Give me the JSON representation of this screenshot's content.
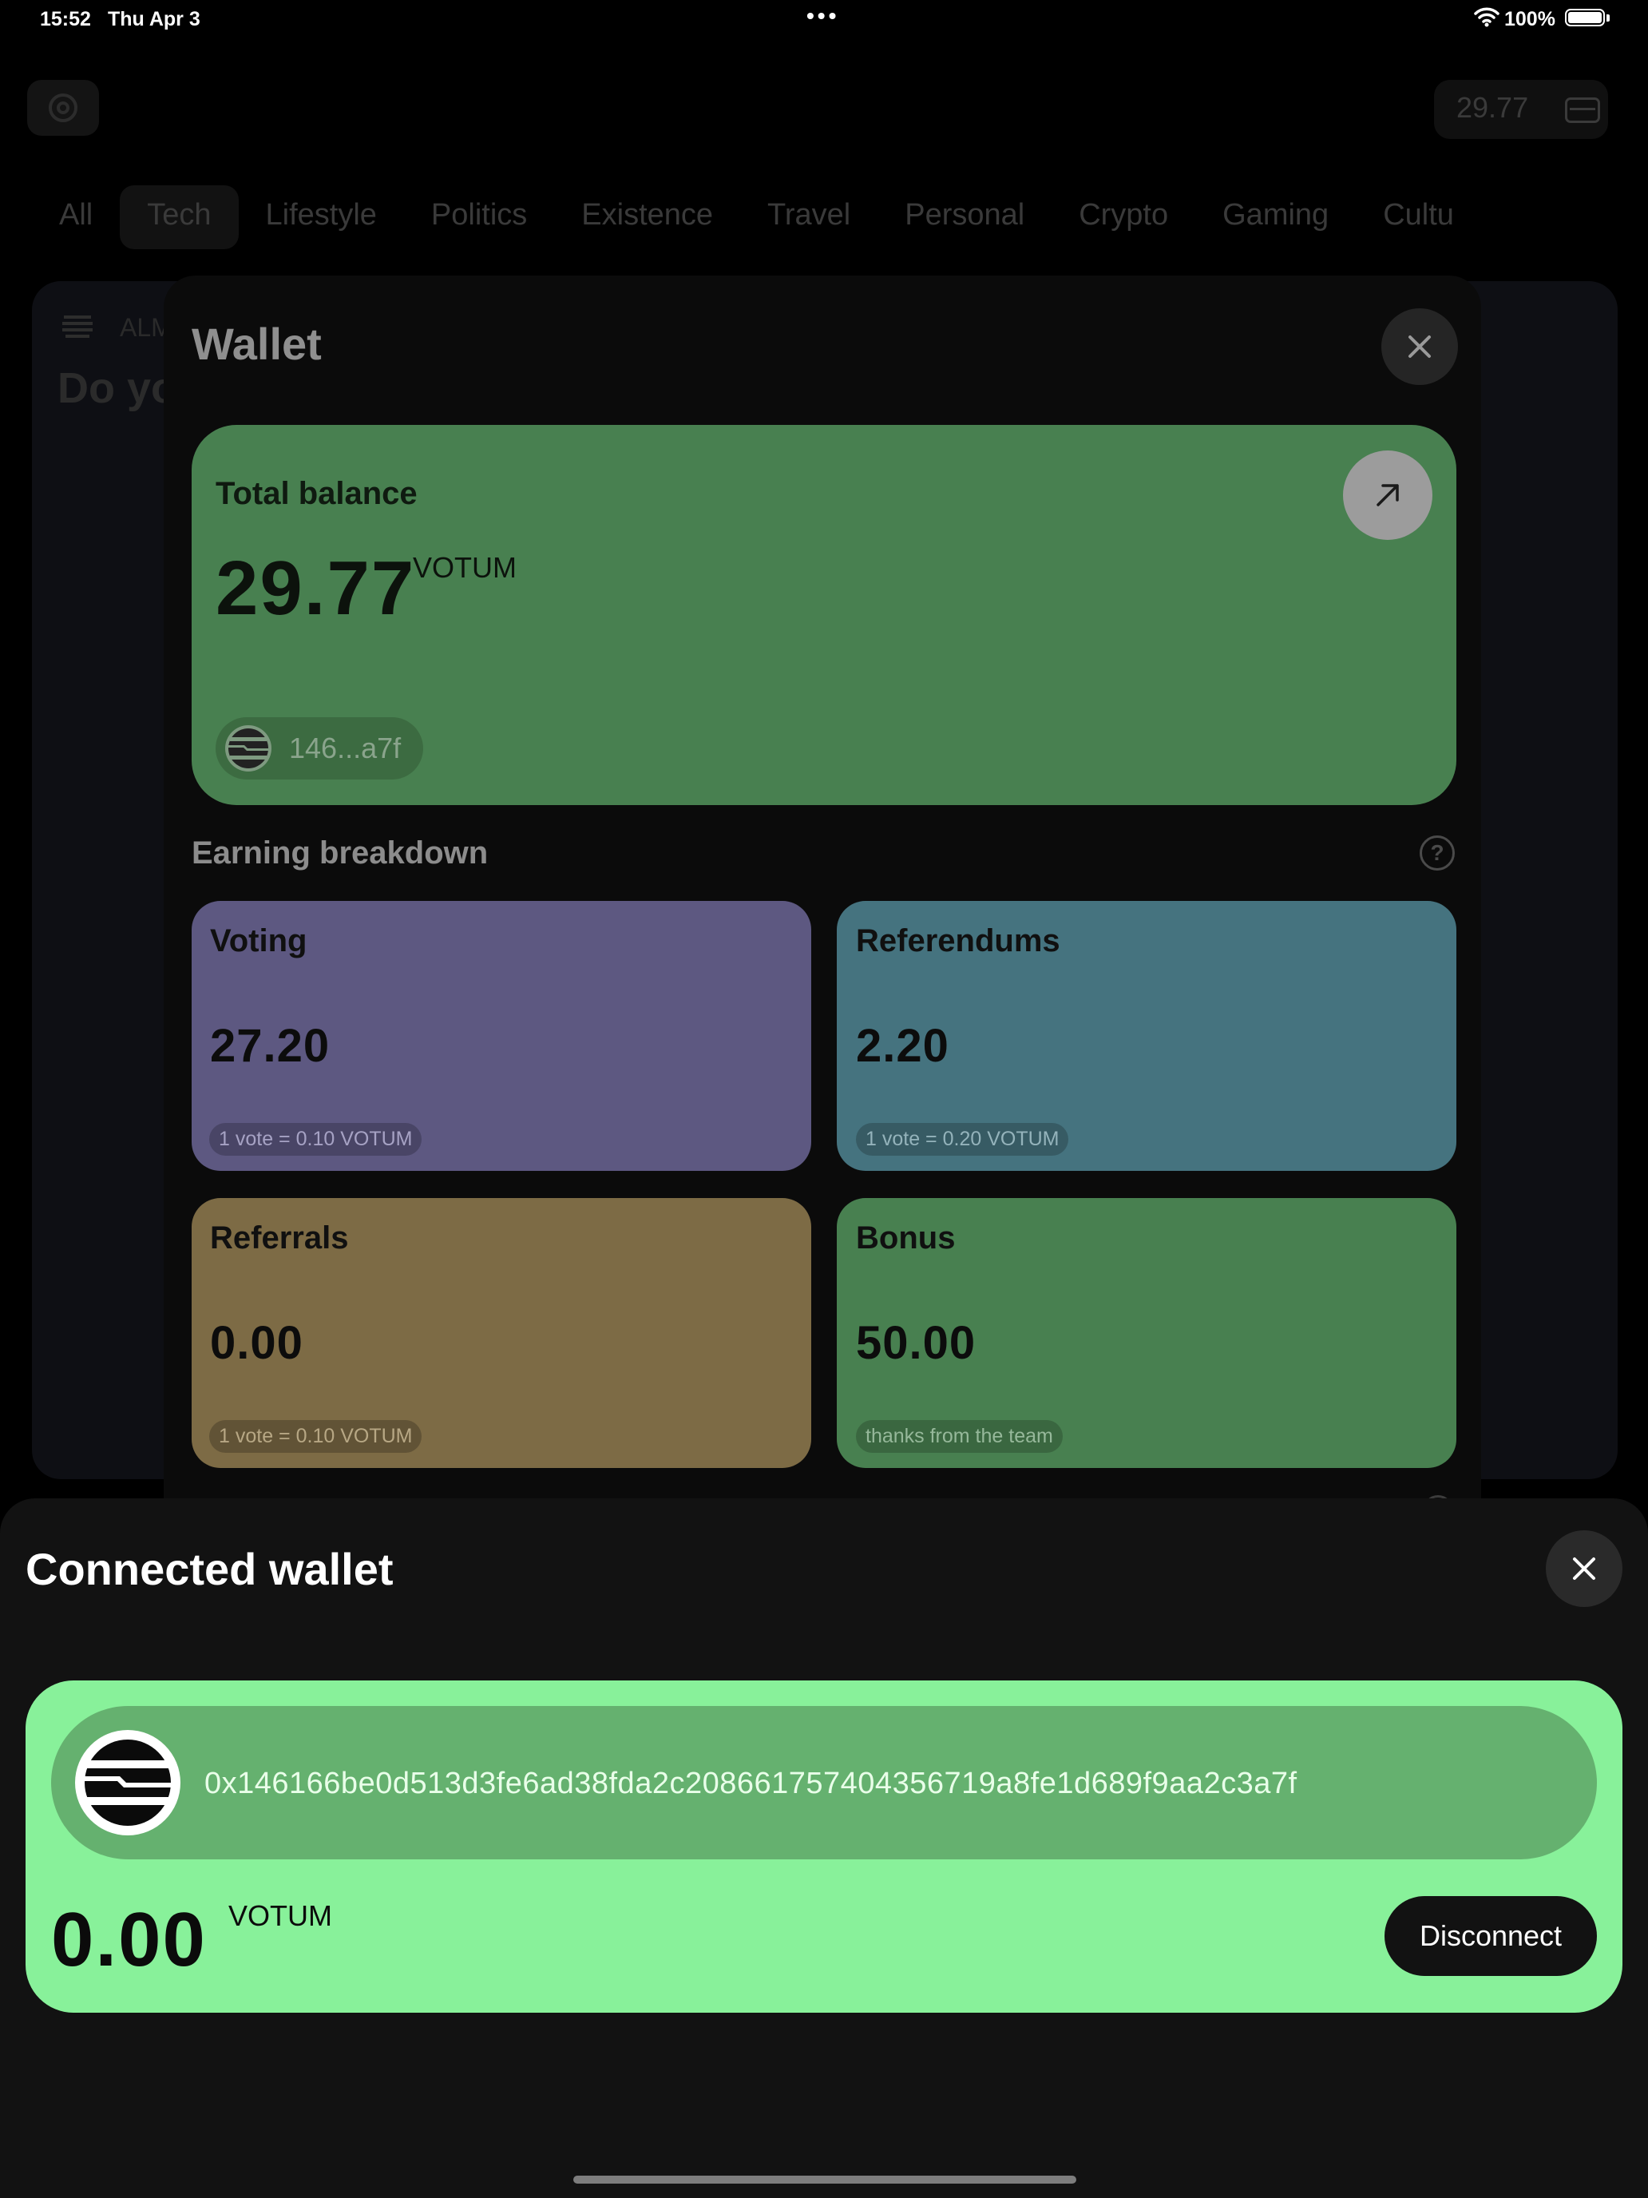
{
  "status_bar": {
    "time": "15:52",
    "date": "Thu Apr 3",
    "dots": "•••",
    "battery": "100%"
  },
  "background": {
    "header_balance": "29.77",
    "categories": [
      "All",
      "Tech",
      "Lifestyle",
      "Politics",
      "Existence",
      "Travel",
      "Personal",
      "Crypto",
      "Gaming",
      "Cultu"
    ],
    "selected_category": "Tech",
    "post_author": "ALM",
    "post_title": "Do yo"
  },
  "wallet": {
    "title": "Wallet",
    "total_label": "Total balance",
    "total_value": "29.77",
    "unit": "VOTUM",
    "short_address": "146...a7f",
    "breakdown_title": "Earning breakdown",
    "help_glyph": "?",
    "cards": [
      {
        "label": "Voting",
        "value": "27.20",
        "note": "1 vote = 0.10 VOTUM"
      },
      {
        "label": "Referendums",
        "value": "2.20",
        "note": "1 vote = 0.20 VOTUM"
      },
      {
        "label": "Referrals",
        "value": "0.00",
        "note": "1 vote = 0.10 VOTUM"
      },
      {
        "label": "Bonus",
        "value": "50.00",
        "note": "thanks from the team"
      }
    ],
    "colors": {
      "total_card": "#488050",
      "voting": "#5d5881",
      "referendums": "#45737f",
      "referrals": "#7d6b45",
      "bonus": "#488050"
    }
  },
  "connected_wallet": {
    "title": "Connected wallet",
    "address": "0x146166be0d513d3fe6ad38fda2c208661757404356719a8fe1d689f9aa2c3a7f",
    "balance": "0.00",
    "unit": "VOTUM",
    "disconnect_label": "Disconnect",
    "card_color": "#88f19a"
  },
  "icons": {
    "wallet_close": "close-icon",
    "arrow": "arrow-up-right-icon",
    "help": "question-icon",
    "aptos_logo": "aptos-logo-icon",
    "card": "card-icon",
    "gear": "gear-icon"
  }
}
